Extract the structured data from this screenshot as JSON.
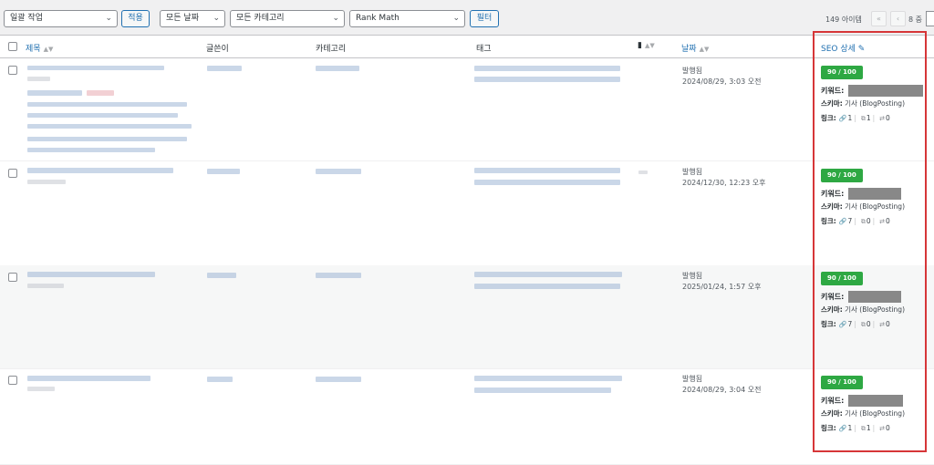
{
  "toolbar": {
    "bulk_action": "일괄 작업",
    "apply": "적용",
    "date_filter": "모든 날짜",
    "category_filter": "모든 카테고리",
    "rankmath_filter": "Rank Math",
    "filter": "필터",
    "item_count": "149 아이템",
    "first_page": "«",
    "prev_page": "‹",
    "page_text": "8 중"
  },
  "columns": {
    "title": "제목",
    "author": "글쓴이",
    "category": "카테고리",
    "tag": "태그",
    "date": "날짜",
    "seo": "SEO 상세"
  },
  "seo_labels": {
    "keyword": "키워드:",
    "schema": "스키마:",
    "links": "링크:"
  },
  "rows": [
    {
      "status": "발행됨",
      "date": "2024/08/29, 3:03 오전",
      "score": "90 / 100",
      "schema": "기사 (BlogPosting)",
      "internal": "1",
      "external": "1",
      "other": "0"
    },
    {
      "status": "발행됨",
      "date": "2024/12/30, 12:23 오후",
      "score": "90 / 100",
      "schema": "기사 (BlogPosting)",
      "internal": "7",
      "external": "0",
      "other": "0"
    },
    {
      "status": "발행됨",
      "date": "2025/01/24, 1:57 오후",
      "score": "90 / 100",
      "schema": "기사 (BlogPosting)",
      "internal": "7",
      "external": "0",
      "other": "0"
    },
    {
      "status": "발행됨",
      "date": "2024/08/29, 3:04 오전",
      "score": "90 / 100",
      "schema": "기사 (BlogPosting)",
      "internal": "1",
      "external": "1",
      "other": "0"
    }
  ],
  "colors": {
    "accent": "#2271b1",
    "score": "#2ea843",
    "highlight": "#d63638"
  }
}
